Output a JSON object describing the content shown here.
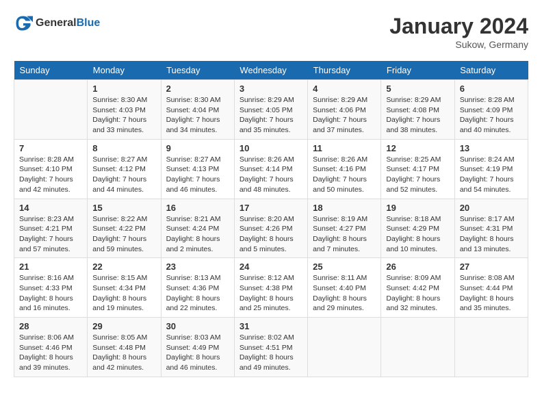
{
  "header": {
    "logo_general": "General",
    "logo_blue": "Blue",
    "title": "January 2024",
    "subtitle": "Sukow, Germany"
  },
  "calendar": {
    "weekdays": [
      "Sunday",
      "Monday",
      "Tuesday",
      "Wednesday",
      "Thursday",
      "Friday",
      "Saturday"
    ],
    "weeks": [
      [
        {
          "day": "",
          "info": ""
        },
        {
          "day": "1",
          "info": "Sunrise: 8:30 AM\nSunset: 4:03 PM\nDaylight: 7 hours\nand 33 minutes."
        },
        {
          "day": "2",
          "info": "Sunrise: 8:30 AM\nSunset: 4:04 PM\nDaylight: 7 hours\nand 34 minutes."
        },
        {
          "day": "3",
          "info": "Sunrise: 8:29 AM\nSunset: 4:05 PM\nDaylight: 7 hours\nand 35 minutes."
        },
        {
          "day": "4",
          "info": "Sunrise: 8:29 AM\nSunset: 4:06 PM\nDaylight: 7 hours\nand 37 minutes."
        },
        {
          "day": "5",
          "info": "Sunrise: 8:29 AM\nSunset: 4:08 PM\nDaylight: 7 hours\nand 38 minutes."
        },
        {
          "day": "6",
          "info": "Sunrise: 8:28 AM\nSunset: 4:09 PM\nDaylight: 7 hours\nand 40 minutes."
        }
      ],
      [
        {
          "day": "7",
          "info": "Sunrise: 8:28 AM\nSunset: 4:10 PM\nDaylight: 7 hours\nand 42 minutes."
        },
        {
          "day": "8",
          "info": "Sunrise: 8:27 AM\nSunset: 4:12 PM\nDaylight: 7 hours\nand 44 minutes."
        },
        {
          "day": "9",
          "info": "Sunrise: 8:27 AM\nSunset: 4:13 PM\nDaylight: 7 hours\nand 46 minutes."
        },
        {
          "day": "10",
          "info": "Sunrise: 8:26 AM\nSunset: 4:14 PM\nDaylight: 7 hours\nand 48 minutes."
        },
        {
          "day": "11",
          "info": "Sunrise: 8:26 AM\nSunset: 4:16 PM\nDaylight: 7 hours\nand 50 minutes."
        },
        {
          "day": "12",
          "info": "Sunrise: 8:25 AM\nSunset: 4:17 PM\nDaylight: 7 hours\nand 52 minutes."
        },
        {
          "day": "13",
          "info": "Sunrise: 8:24 AM\nSunset: 4:19 PM\nDaylight: 7 hours\nand 54 minutes."
        }
      ],
      [
        {
          "day": "14",
          "info": "Sunrise: 8:23 AM\nSunset: 4:21 PM\nDaylight: 7 hours\nand 57 minutes."
        },
        {
          "day": "15",
          "info": "Sunrise: 8:22 AM\nSunset: 4:22 PM\nDaylight: 7 hours\nand 59 minutes."
        },
        {
          "day": "16",
          "info": "Sunrise: 8:21 AM\nSunset: 4:24 PM\nDaylight: 8 hours\nand 2 minutes."
        },
        {
          "day": "17",
          "info": "Sunrise: 8:20 AM\nSunset: 4:26 PM\nDaylight: 8 hours\nand 5 minutes."
        },
        {
          "day": "18",
          "info": "Sunrise: 8:19 AM\nSunset: 4:27 PM\nDaylight: 8 hours\nand 7 minutes."
        },
        {
          "day": "19",
          "info": "Sunrise: 8:18 AM\nSunset: 4:29 PM\nDaylight: 8 hours\nand 10 minutes."
        },
        {
          "day": "20",
          "info": "Sunrise: 8:17 AM\nSunset: 4:31 PM\nDaylight: 8 hours\nand 13 minutes."
        }
      ],
      [
        {
          "day": "21",
          "info": "Sunrise: 8:16 AM\nSunset: 4:33 PM\nDaylight: 8 hours\nand 16 minutes."
        },
        {
          "day": "22",
          "info": "Sunrise: 8:15 AM\nSunset: 4:34 PM\nDaylight: 8 hours\nand 19 minutes."
        },
        {
          "day": "23",
          "info": "Sunrise: 8:13 AM\nSunset: 4:36 PM\nDaylight: 8 hours\nand 22 minutes."
        },
        {
          "day": "24",
          "info": "Sunrise: 8:12 AM\nSunset: 4:38 PM\nDaylight: 8 hours\nand 25 minutes."
        },
        {
          "day": "25",
          "info": "Sunrise: 8:11 AM\nSunset: 4:40 PM\nDaylight: 8 hours\nand 29 minutes."
        },
        {
          "day": "26",
          "info": "Sunrise: 8:09 AM\nSunset: 4:42 PM\nDaylight: 8 hours\nand 32 minutes."
        },
        {
          "day": "27",
          "info": "Sunrise: 8:08 AM\nSunset: 4:44 PM\nDaylight: 8 hours\nand 35 minutes."
        }
      ],
      [
        {
          "day": "28",
          "info": "Sunrise: 8:06 AM\nSunset: 4:46 PM\nDaylight: 8 hours\nand 39 minutes."
        },
        {
          "day": "29",
          "info": "Sunrise: 8:05 AM\nSunset: 4:48 PM\nDaylight: 8 hours\nand 42 minutes."
        },
        {
          "day": "30",
          "info": "Sunrise: 8:03 AM\nSunset: 4:49 PM\nDaylight: 8 hours\nand 46 minutes."
        },
        {
          "day": "31",
          "info": "Sunrise: 8:02 AM\nSunset: 4:51 PM\nDaylight: 8 hours\nand 49 minutes."
        },
        {
          "day": "",
          "info": ""
        },
        {
          "day": "",
          "info": ""
        },
        {
          "day": "",
          "info": ""
        }
      ]
    ]
  }
}
